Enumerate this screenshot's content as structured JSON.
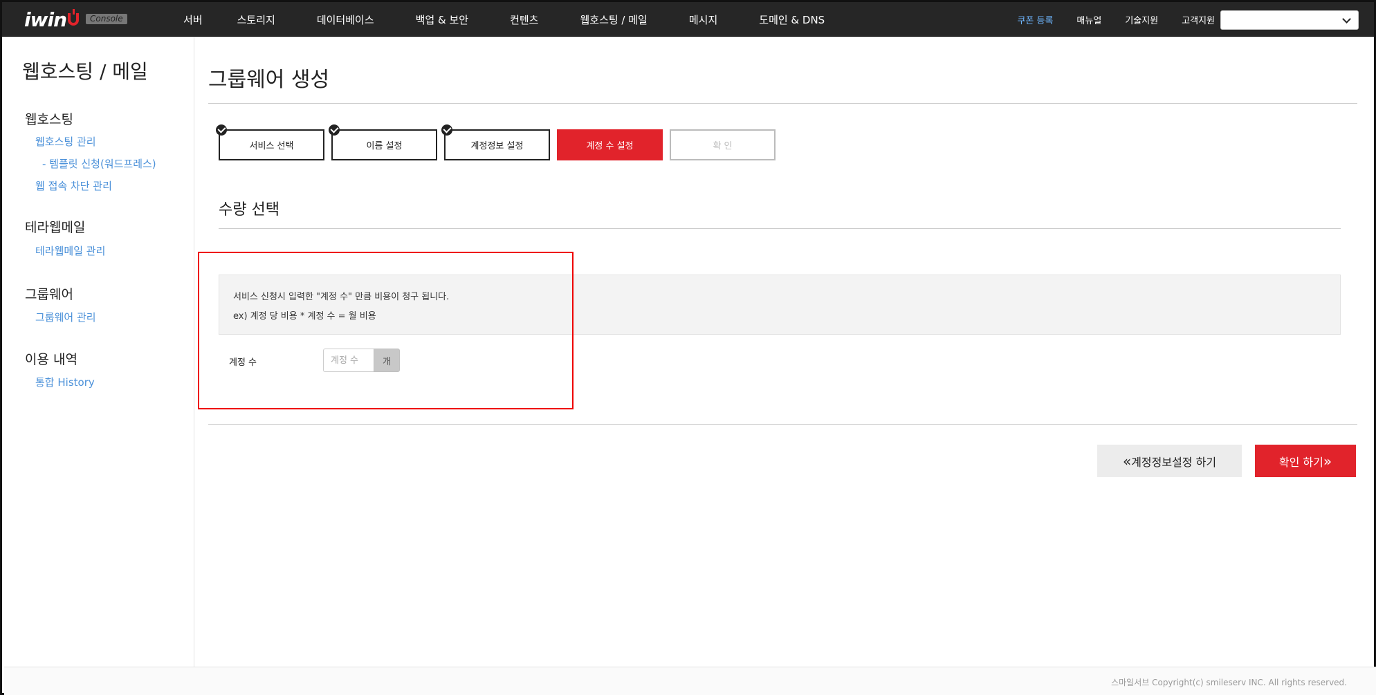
{
  "header": {
    "logo_text": "iwin",
    "logo_badge": "Console",
    "nav": [
      "서버",
      "스토리지",
      "데이터베이스",
      "백업 & 보안",
      "컨텐츠",
      "웹호스팅 / 메일",
      "메시지",
      "도메인 & DNS"
    ],
    "util": {
      "coupon": "쿠폰 등록",
      "manual": "매뉴얼",
      "tech_support": "기술지원",
      "customer_support": "고객지원"
    },
    "select_value": ""
  },
  "sidebar": {
    "title": "웹호스팅 / 메일",
    "groups": [
      {
        "label": "웹호스팅",
        "links": [
          "웹호스팅 관리",
          "- 템플릿 신청(워드프레스)",
          "웹 접속 차단 관리"
        ]
      },
      {
        "label": "테라웹메일",
        "links": [
          "테라웹메일 관리"
        ]
      },
      {
        "label": "그룹웨어",
        "links": [
          "그룹웨어 관리"
        ]
      },
      {
        "label": "이용 내역",
        "links": [
          "통합 History"
        ]
      }
    ]
  },
  "main": {
    "title": "그룹웨어 생성",
    "steps": [
      {
        "label": "서비스 선택",
        "state": "done"
      },
      {
        "label": "이름 설정",
        "state": "done"
      },
      {
        "label": "계정정보 설정",
        "state": "done"
      },
      {
        "label": "계정 수 설정",
        "state": "active"
      },
      {
        "label": "확 인",
        "state": "disabled"
      }
    ],
    "section_title": "수량 선택",
    "info_lines": [
      "서비스 신청시 입력한 \"계정 수\" 만큼 비용이 청구 됩니다.",
      "ex) 계정 당 비용 * 계정 수 = 월 비용"
    ],
    "quantity": {
      "label": "계정 수",
      "placeholder": "계정 수",
      "value": "",
      "unit": "개"
    },
    "buttons": {
      "prev_icon": "«",
      "prev_label": "계정정보설정 하기",
      "next_label": "확인 하기",
      "next_icon": "»"
    }
  },
  "footer": {
    "copyright": "스마일서브 Copyright(c) smileserv INC. All rights reserved."
  },
  "colors": {
    "accent": "#e1232b",
    "link": "#4a90d9",
    "topbar": "#262626",
    "highlight": "#ee0000"
  }
}
